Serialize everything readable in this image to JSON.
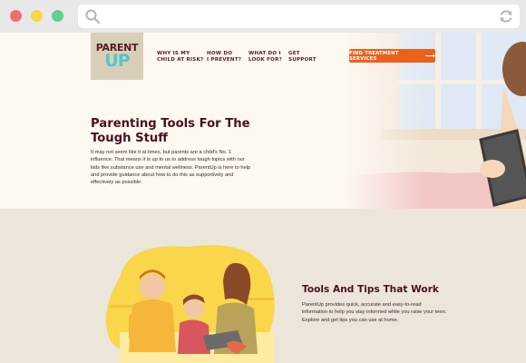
{
  "browser": {
    "controls": [
      "close",
      "minimize",
      "maximize"
    ],
    "icons": {
      "search": "search-icon",
      "refresh": "refresh-icon"
    }
  },
  "header": {
    "logo": {
      "line1": "PARENT",
      "line2": "UP"
    },
    "nav": [
      {
        "label": "WHY IS MY\nCHILD AT RISK?"
      },
      {
        "label": "HOW DO\nI PREVENT?"
      },
      {
        "label": "WHAT DO I\nLOOK FOR?"
      },
      {
        "label": "GET\nSUPPORT"
      }
    ],
    "cta": {
      "label": "FIND TREATMENT SERVICES",
      "icon": "arrow-right-icon"
    }
  },
  "hero": {
    "title": "Parenting Tools For The Tough Stuff",
    "body": "It may not seem like it at times, but parents are a child's No. 1 influence. That means it is up to us to address tough topics with our kids like substance use and mental wellness. ParentUp is here to help and provide guidance about how to do this as supportively and effectively as possible."
  },
  "section2": {
    "title": "Tools And Tips That Work",
    "body": "ParentUp provides quick, accurate and easy-to-read information to help you stay informed while you raise your teen. Explore and get tips you can use at home."
  },
  "colors": {
    "brand_maroon": "#4a1020",
    "cta_orange": "#e8621c",
    "logo_teal": "#4fc9c6",
    "hero_bg": "#fdf8f0",
    "section_bg": "#ebe6d9",
    "illustration_yellow": "#f9d64a"
  }
}
